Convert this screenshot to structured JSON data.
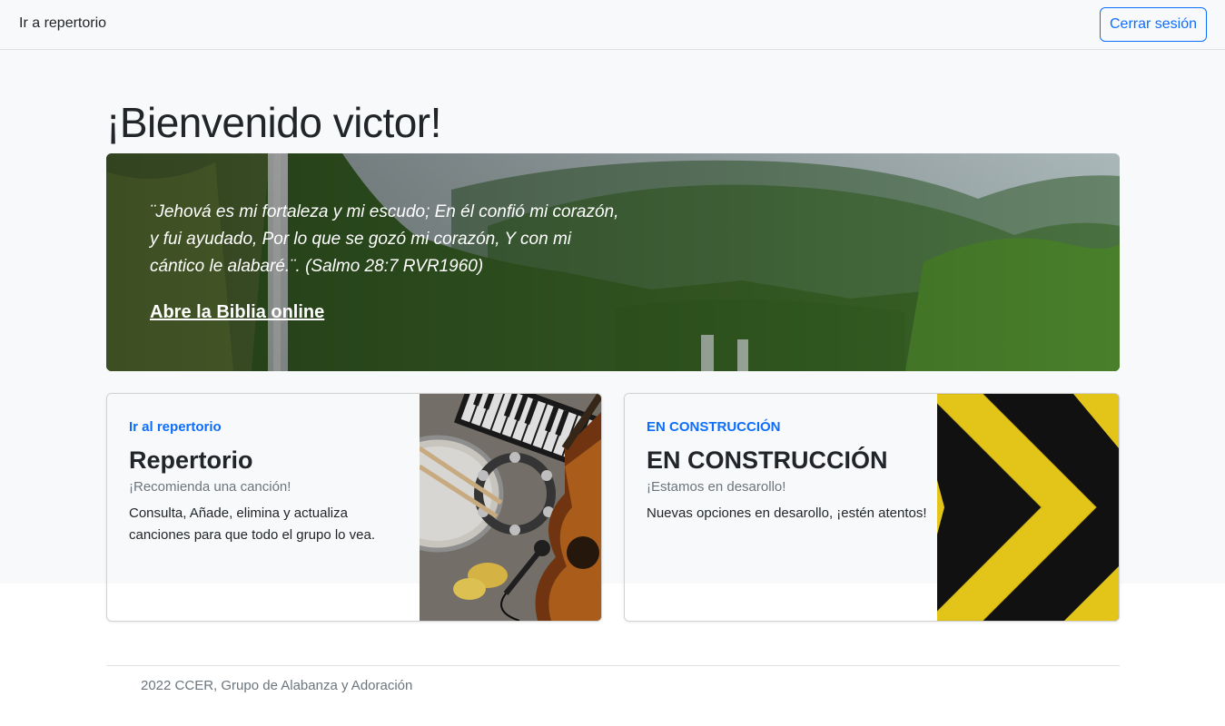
{
  "nav": {
    "link_label": "Ir a repertorio",
    "logout_label": "Cerrar sesión"
  },
  "welcome": "¡Bienvenido victor!",
  "hero": {
    "verse": "¨Jehová es mi fortaleza y mi escudo; En él confió mi corazón, y fui ayudado, Por lo que se gozó mi corazón, Y con mi cántico le alabaré.¨. (Salmo 28:7 RVR1960)",
    "link_label": "Abre la Biblia online"
  },
  "cards": [
    {
      "link_label": "Ir al repertorio",
      "title": "Repertorio",
      "subtitle": "¡Recomienda una canción!",
      "text": "Consulta, Añade, elimina y actualiza canciones para que todo el grupo lo vea."
    },
    {
      "link_label": "EN CONSTRUCCIÓN",
      "title": "EN CONSTRUCCIÓN",
      "subtitle": "¡Estamos en desarollo!",
      "text": "Nuevas opciones en desarollo, ¡estén atentos!"
    }
  ],
  "footer": "2022 CCER, Grupo de Alabanza y Adoración",
  "colors": {
    "primary": "#0d6efd",
    "muted": "#6c757d",
    "light_bg": "#f8f9fa",
    "warning_yellow": "#e3c51a"
  }
}
